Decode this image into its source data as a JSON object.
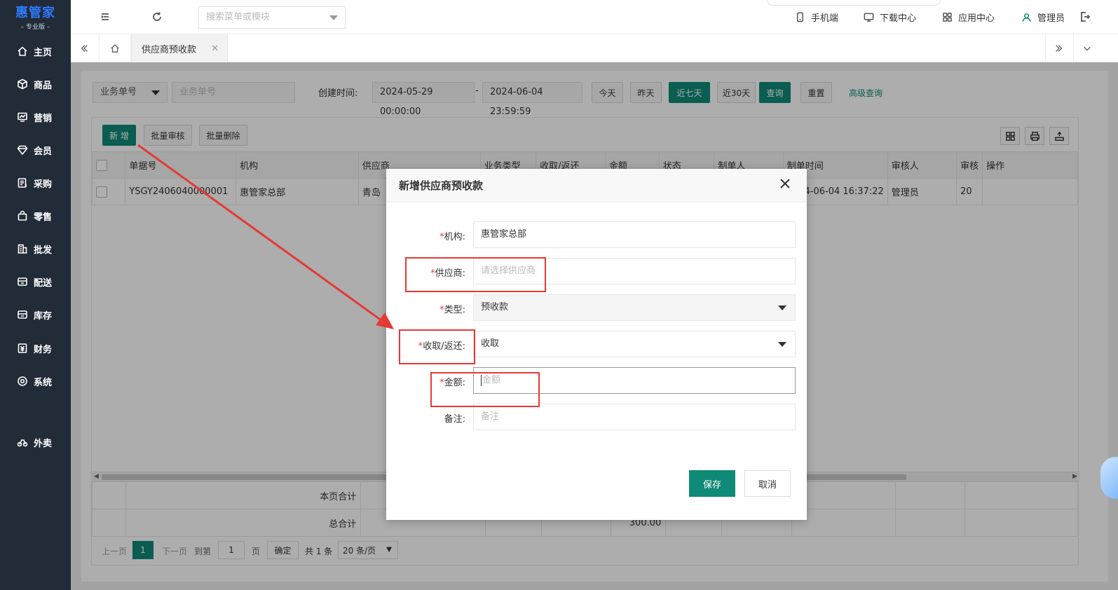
{
  "brand": {
    "name": "惠管家",
    "edition": "专业版"
  },
  "sidebar": {
    "items": [
      {
        "label": "主页",
        "icon": "home-icon"
      },
      {
        "label": "商品",
        "icon": "cube-icon"
      },
      {
        "label": "营销",
        "icon": "chart-icon"
      },
      {
        "label": "会员",
        "icon": "diamond-icon"
      },
      {
        "label": "采购",
        "icon": "purchase-icon"
      },
      {
        "label": "零售",
        "icon": "bag-icon"
      },
      {
        "label": "批发",
        "icon": "building-icon"
      },
      {
        "label": "配送",
        "icon": "delivery-icon"
      },
      {
        "label": "库存",
        "icon": "inventory-icon"
      },
      {
        "label": "财务",
        "icon": "finance-icon"
      },
      {
        "label": "系统",
        "icon": "settings-icon"
      },
      {
        "label": "外卖",
        "icon": "bike-icon"
      }
    ]
  },
  "topbar": {
    "search_placeholder": "搜索菜单或模块",
    "links": {
      "mobile": "手机端",
      "download": "下载中心",
      "apps": "应用中心",
      "user": "管理员"
    }
  },
  "tabs": {
    "active": "供应商预收款"
  },
  "filters": {
    "field_select": "业务单号",
    "field_placeholder": "业务单号",
    "created_label": "创建时间:",
    "date_start": "2024-05-29 00:00:00",
    "date_sep": "-",
    "date_end": "2024-06-04 23:59:59",
    "today": "今天",
    "yesterday": "昨天",
    "last7": "近七天",
    "last30": "近30天",
    "query": "查询",
    "reset": "重置",
    "advanced": "高级查询"
  },
  "toolbar": {
    "add": "新 增",
    "batch_audit": "批量审核",
    "batch_delete": "批量删除"
  },
  "table": {
    "columns": [
      "单据号",
      "机构",
      "供应商",
      "业务类型",
      "收取/返还",
      "金额",
      "状态",
      "制单人",
      "制单时间",
      "审核人",
      "审核",
      "操作"
    ],
    "rows": [
      [
        "YSGY2406040000001",
        "惠管家总部",
        "青岛",
        "",
        "",
        "",
        "",
        "",
        "2024-06-04 16:37:22",
        "管理员",
        "20",
        ""
      ]
    ]
  },
  "footer": {
    "page_total": "本页合计",
    "grand_total": "总合计",
    "grand_amount": "300.00"
  },
  "pager": {
    "prev": "上一页",
    "current": "1",
    "next": "下一页",
    "goto": "到第",
    "page_input": "1",
    "page_unit": "页",
    "confirm": "确定",
    "total": "共 1 条",
    "page_size": "20 条/页"
  },
  "modal": {
    "title": "新增供应商预收款",
    "fields": {
      "org": {
        "label": "机构:",
        "value": "惠管家总部"
      },
      "supplier": {
        "label": "供应商:",
        "placeholder": "请选择供应商"
      },
      "type": {
        "label": "类型:",
        "value": "预收款"
      },
      "direction": {
        "label": "收取/返还:",
        "value": "收取"
      },
      "amount": {
        "label": "金额:",
        "placeholder": "金额"
      },
      "remark": {
        "label": "备注:",
        "placeholder": "备注"
      }
    },
    "required_mark": "*",
    "save": "保存",
    "cancel": "取消"
  },
  "colors": {
    "primary": "#0f8a76",
    "sidebar": "#222b38",
    "annotation": "#e53935",
    "brand": "#2f7bff"
  }
}
